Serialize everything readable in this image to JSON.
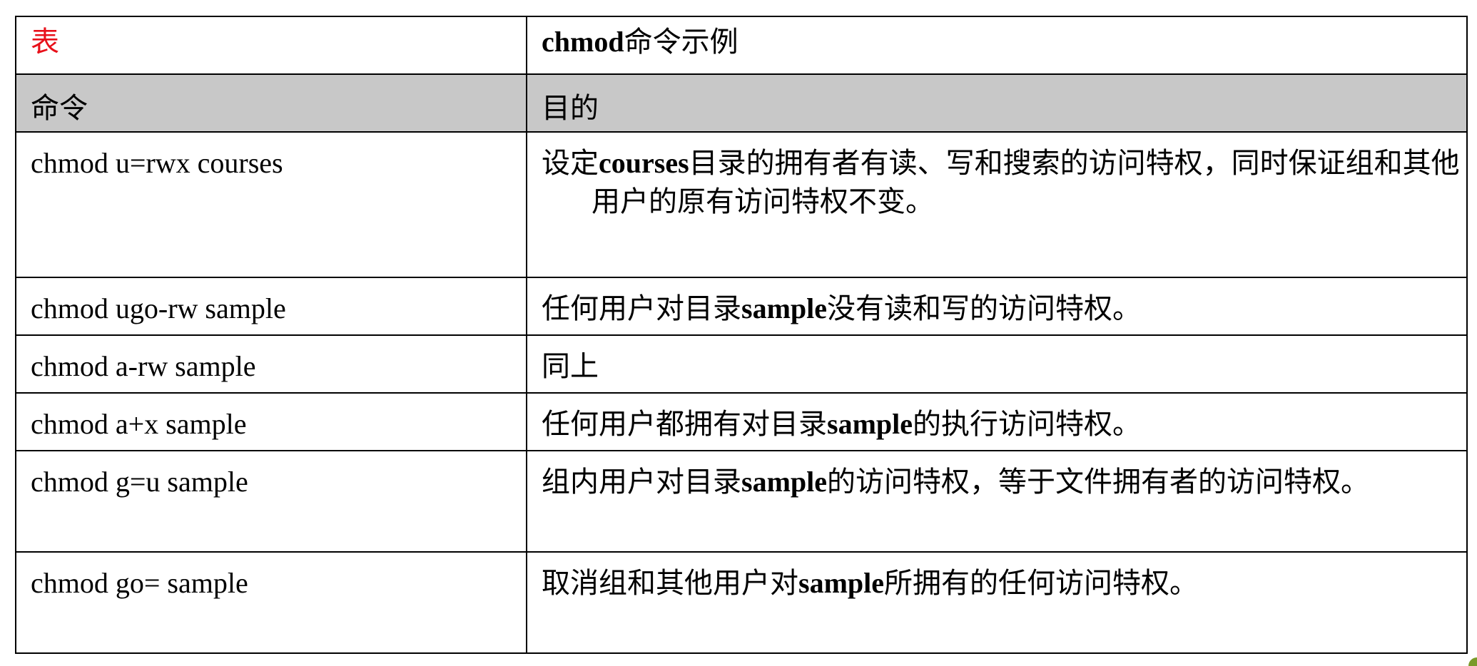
{
  "table": {
    "caption_label": "表",
    "caption_cmd": "chmod",
    "caption_rest": "命令示例",
    "header": {
      "col1": "命令",
      "col2": "目的"
    },
    "rows": [
      {
        "command": "chmod u=rwx courses",
        "purpose": [
          {
            "text": "设定",
            "bold": false
          },
          {
            "text": "courses",
            "bold": true
          },
          {
            "text": "目录的拥有者有读、写和搜索的访问特权，同时保证组和其他用户的原有访问特权不变。",
            "bold": false
          }
        ]
      },
      {
        "command": "chmod ugo-rw sample",
        "purpose": [
          {
            "text": "任何用户对目录",
            "bold": false
          },
          {
            "text": "sample",
            "bold": true
          },
          {
            "text": "没有读和写的访问特权。",
            "bold": false
          }
        ]
      },
      {
        "command": "chmod a-rw sample",
        "purpose": [
          {
            "text": "同上",
            "bold": false
          }
        ]
      },
      {
        "command": "chmod a+x sample",
        "purpose": [
          {
            "text": "任何用户都拥有对目录",
            "bold": false
          },
          {
            "text": "sample",
            "bold": true
          },
          {
            "text": "的执行访问特权。",
            "bold": false
          }
        ]
      },
      {
        "command": "chmod g=u sample",
        "purpose": [
          {
            "text": "组内用户对目录",
            "bold": false
          },
          {
            "text": "sample",
            "bold": true
          },
          {
            "text": "的访问特权，等于文件拥有者的访问特权。",
            "bold": false
          }
        ]
      },
      {
        "command": "chmod go= sample",
        "purpose": [
          {
            "text": "取消组和其他用户对",
            "bold": false
          },
          {
            "text": "sample",
            "bold": true
          },
          {
            "text": "所拥有的任何访问特权。",
            "bold": false
          }
        ]
      }
    ]
  },
  "colors": {
    "caption_label": "#e8101a",
    "header_background": "#c8c8c8",
    "border": "#000000",
    "corner_mark": "#7a9a2a"
  }
}
